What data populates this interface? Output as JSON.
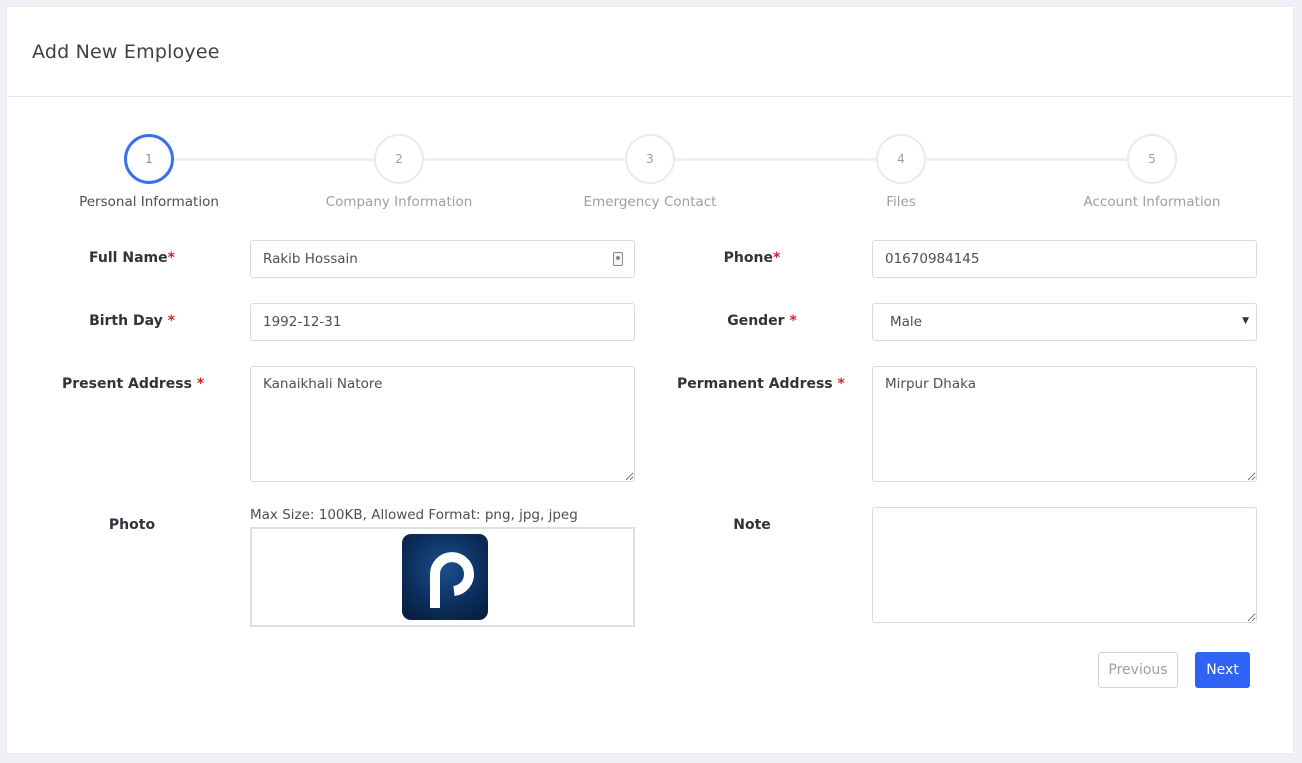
{
  "page": {
    "title": "Add New Employee"
  },
  "steps": [
    {
      "number": "1",
      "label": "Personal Information",
      "active": true
    },
    {
      "number": "2",
      "label": "Company Information",
      "active": false
    },
    {
      "number": "3",
      "label": "Emergency Contact",
      "active": false
    },
    {
      "number": "4",
      "label": "Files",
      "active": false
    },
    {
      "number": "5",
      "label": "Account Information",
      "active": false
    }
  ],
  "form": {
    "full_name": {
      "label": "Full Name",
      "required_mark": "*",
      "value": "Rakib Hossain"
    },
    "phone": {
      "label": "Phone",
      "required_mark": "*",
      "value": "01670984145"
    },
    "birth_day": {
      "label": "Birth Day",
      "required_mark": "*",
      "value": "1992-12-31"
    },
    "gender": {
      "label": "Gender",
      "required_mark": "*",
      "value": "Male"
    },
    "present_address": {
      "label": "Present Address",
      "required_mark": "*",
      "value": "Kanaikhali Natore"
    },
    "permanent_address": {
      "label": "Permanent Address",
      "required_mark": "*",
      "value": "Mirpur Dhaka"
    },
    "photo": {
      "label": "Photo",
      "hint": "Max Size: 100KB, Allowed Format: png, jpg, jpeg"
    },
    "note": {
      "label": "Note",
      "value": ""
    }
  },
  "buttons": {
    "previous": "Previous",
    "next": "Next"
  },
  "colors": {
    "accent": "#2f63f5",
    "required": "#d9232f",
    "logo_bg": "#0c2f5e"
  },
  "icons": {
    "contact": "contact-card-icon",
    "caret": "chevron-down-icon"
  }
}
